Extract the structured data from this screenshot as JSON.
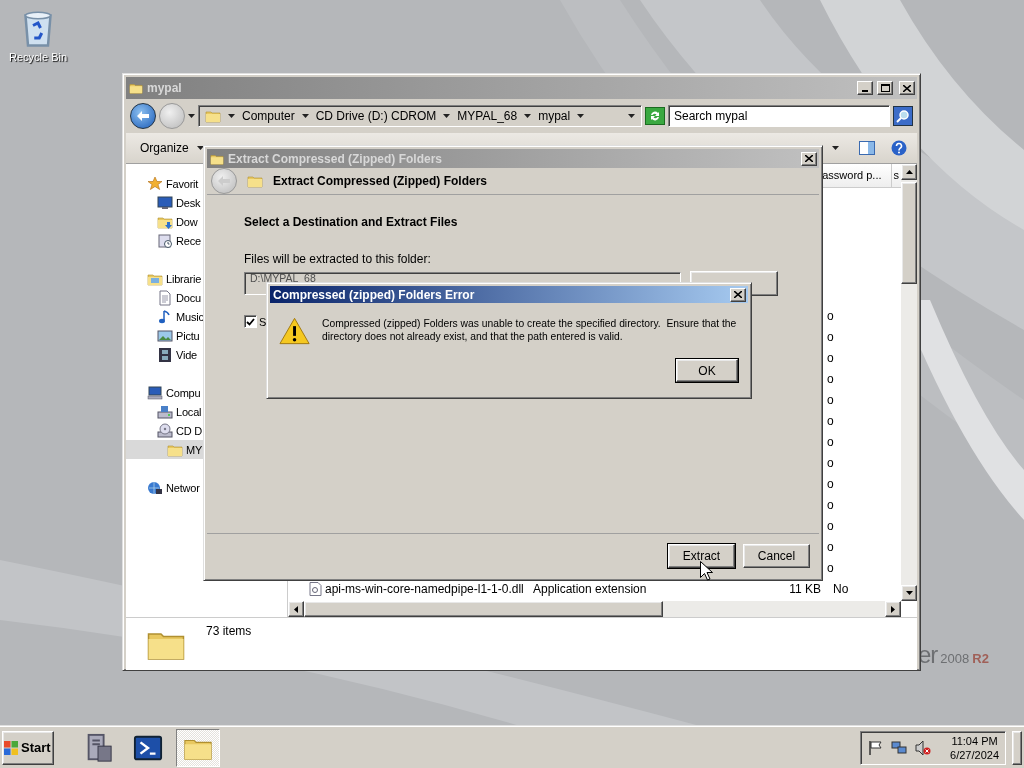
{
  "desktop": {
    "icons": [
      {
        "label": "Recycle Bin",
        "kind": "recycle-bin"
      }
    ],
    "wallpaper_texts": [
      "er",
      "2008",
      "R2"
    ]
  },
  "explorer": {
    "title": "mypal",
    "breadcrumbs": [
      "Computer",
      "CD Drive (D:) CDROM",
      "MYPAL_68",
      "mypal"
    ],
    "search": {
      "placeholder": "Search mypal"
    },
    "toolbar": [
      "Organize"
    ],
    "nav": [
      {
        "label": "Favorit",
        "kind": "star",
        "selected": false,
        "children": [
          {
            "label": "Desk",
            "kind": "monitor",
            "selected": false
          },
          {
            "label": "Dow",
            "kind": "download",
            "selected": false
          },
          {
            "label": "Rece",
            "kind": "recent",
            "selected": false
          }
        ]
      },
      {
        "label": "Librarie",
        "kind": "library",
        "selected": false,
        "children": [
          {
            "label": "Docu",
            "kind": "document",
            "selected": false
          },
          {
            "label": "Music",
            "kind": "music",
            "selected": false
          },
          {
            "label": "Pictu",
            "kind": "picture",
            "selected": false
          },
          {
            "label": "Vide",
            "kind": "video",
            "selected": false
          }
        ]
      },
      {
        "label": "Compu",
        "kind": "computer",
        "selected": false,
        "children": [
          {
            "label": "Local",
            "kind": "drive",
            "selected": false
          },
          {
            "label": "CD D",
            "kind": "cdrom",
            "selected": false,
            "children": [
              {
                "label": "MY",
                "kind": "folder",
                "selected": true
              }
            ]
          }
        ]
      },
      {
        "label": "Networ",
        "kind": "network",
        "selected": false
      }
    ],
    "columns": [
      "assword p...",
      "s"
    ],
    "rows": [
      {
        "column_5": "o"
      },
      {
        "column_5": "o"
      },
      {
        "column_5": "o"
      },
      {
        "column_5": "o"
      },
      {
        "column_5": "o"
      },
      {
        "column_5": "o"
      },
      {
        "column_5": "o"
      },
      {
        "column_5": "o"
      },
      {
        "column_5": "o"
      },
      {
        "column_5": "o"
      },
      {
        "column_5": "o"
      },
      {
        "column_5": "o"
      },
      {
        "column_5": "o"
      }
    ],
    "last_row": {
      "name": "api-ms-win-core-namedpipe-l1-1-0.dll",
      "type": "Application extension",
      "size": "11 KB",
      "column_5": "No"
    },
    "status": "73 items"
  },
  "extract_dialog": {
    "title": "Extract Compressed (Zipped) Folders",
    "heading": "Extract Compressed (Zipped) Folders",
    "section": "Select a Destination and Extract Files",
    "field_label": "Files will be extracted to this folder:",
    "field_value": "D:\\MYPAL_68",
    "checkbox": {
      "label": "S",
      "checked": true
    },
    "buttons": [
      {
        "label": "Extract",
        "default": true
      },
      {
        "label": "Cancel",
        "default": false
      }
    ]
  },
  "error_dialog": {
    "title": "Compressed (zipped) Folders Error",
    "message": "Compressed (zipped) Folders was unable to create the specified directory.  Ensure that the directory does not already exist, and that the path entered is valid.",
    "button": "OK"
  },
  "taskbar": {
    "start": "Start",
    "apps": [
      {
        "kind": "server",
        "selected": false
      },
      {
        "kind": "powershell",
        "selected": false
      },
      {
        "kind": "explorer",
        "selected": true
      }
    ],
    "time": "11:04 PM",
    "date": "6/27/2024"
  }
}
